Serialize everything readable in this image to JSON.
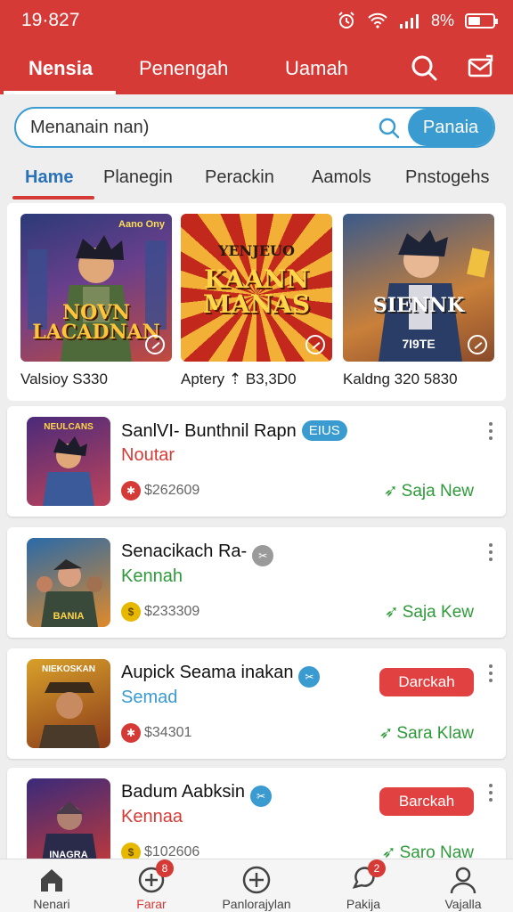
{
  "status": {
    "time": "19·827",
    "battery": "8%"
  },
  "top_tabs": [
    "Nensia",
    "Penengah",
    "Uamah"
  ],
  "search": {
    "value": "Menanain nan)",
    "button": "Panaia"
  },
  "categories": [
    "Hame",
    "Planegin",
    "Perackin",
    "Aamols",
    "Pnstogehs"
  ],
  "featured": [
    {
      "art_text": "NOVN LACADNAN",
      "badge": "Aano Ony",
      "caption": "Valsioy S330"
    },
    {
      "art_text": "KAANN MANAS",
      "badge": "YENJEUO",
      "caption": "Aptery ⇡ B3,3D0"
    },
    {
      "art_text": "SIENNK",
      "badge": "7I9TE",
      "caption": "Kaldng 320 5830"
    }
  ],
  "games": [
    {
      "title": "SanlVI- Bunthnil Rapn",
      "badge": "EIUS",
      "subtitle": "Noutar",
      "subtitle_color": "#d63a36",
      "price": "$262609",
      "action": "Saja New",
      "coin_color": "#d63a36",
      "thumb_text": "NEULCANS"
    },
    {
      "title": "Senacikach Ra-",
      "badge": "",
      "subtitle": "Kennah",
      "subtitle_color": "#2e9a3a",
      "price": "$233309",
      "action": "Saja Kew",
      "coin_color": "#e6b800",
      "thumb_text": "BANIA"
    },
    {
      "title": "Aupick Seama inakan",
      "badge": "",
      "subtitle": "Semad",
      "subtitle_color": "#3a9bd0",
      "price": "$34301",
      "action": "Sara Klaw",
      "coin_color": "#d63a36",
      "button": "Darckah",
      "thumb_text": "NIEKOSKAN"
    },
    {
      "title": "Badum Aabksin",
      "badge": "",
      "subtitle": "Kennaa",
      "subtitle_color": "#d63a36",
      "price": "$102606",
      "action": "Saro Naw",
      "coin_color": "#e6b800",
      "button": "Barckah",
      "thumb_text": "INAGRA"
    }
  ],
  "bottom_nav": [
    {
      "label": "Nenari",
      "icon": "home-icon",
      "badge": ""
    },
    {
      "label": "Farar",
      "icon": "plus-circle-icon",
      "badge": "8"
    },
    {
      "label": "Panlorajylan",
      "icon": "plus-circle-icon",
      "badge": ""
    },
    {
      "label": "Pakija",
      "icon": "chat-icon",
      "badge": "2"
    },
    {
      "label": "Vajalla",
      "icon": "user-icon",
      "badge": ""
    }
  ],
  "colors": {
    "brand_red": "#d63a36",
    "accent_blue": "#3a9bd0",
    "green": "#2e9a3a"
  }
}
